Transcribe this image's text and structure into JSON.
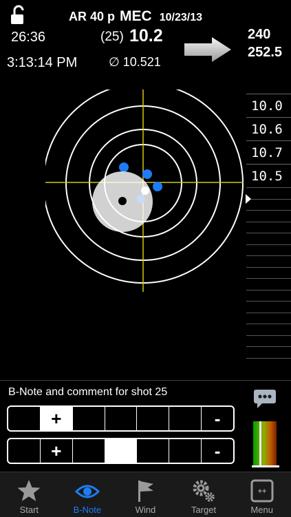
{
  "header": {
    "event": "AR 40 p",
    "range": "MEC",
    "date": "10/23/13",
    "timer": "26:36",
    "clock": "3:13:14 PM",
    "shot_number": "(25)",
    "shot_score": "10.2",
    "average": "∅ 10.521",
    "total_a": "240",
    "total_b": "252.5"
  },
  "scores": [
    "10.0",
    "10.6",
    "10.7",
    "10.5"
  ],
  "bnote": {
    "label": "B-Note and comment for shot 25",
    "row1": [
      "",
      "+",
      "",
      "",
      "",
      "",
      "-"
    ],
    "row2": [
      "",
      "+",
      "",
      "",
      "",
      "",
      "-"
    ]
  },
  "tabs": [
    {
      "label": "Start",
      "icon": "star-icon"
    },
    {
      "label": "B-Note",
      "icon": "eye-icon"
    },
    {
      "label": "Wind",
      "icon": "flag-icon"
    },
    {
      "label": "Target",
      "icon": "gears-icon"
    },
    {
      "label": "Menu",
      "icon": "menu-icon"
    }
  ],
  "colors": {
    "accent": "#1e7cf5",
    "crosshair": "#d4c814",
    "shot": "#1e7cf5"
  }
}
